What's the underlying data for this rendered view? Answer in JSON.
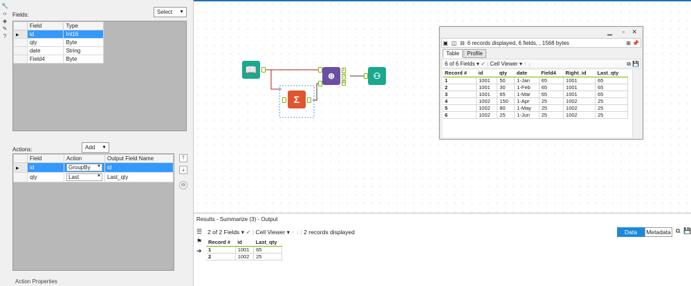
{
  "left_panel": {
    "fields_label": "Fields:",
    "select_button": "Select",
    "fields_headers": [
      "Field",
      "Type"
    ],
    "fields_rows": [
      {
        "field": "id",
        "type": "Int16",
        "selected": true
      },
      {
        "field": "qty",
        "type": "Byte",
        "selected": false
      },
      {
        "field": "date",
        "type": "String",
        "selected": false
      },
      {
        "field": "Field4",
        "type": "Byte",
        "selected": false
      }
    ],
    "actions_label": "Actions:",
    "add_button": "Add",
    "actions_headers": [
      "Field",
      "Action",
      "Output Field Name"
    ],
    "actions_rows": [
      {
        "field": "id",
        "action": "GroupBy",
        "output": "id",
        "selected": true
      },
      {
        "field": "qty",
        "action": "Last",
        "output": "Last_qty",
        "selected": false
      }
    ],
    "action_properties_label": "Action Properties"
  },
  "browse_window": {
    "status_text": "6 records displayed, 6 fields, , 1568 bytes",
    "tabs": [
      "Table",
      "Profile"
    ],
    "fields_selector": "6 of 6 Fields",
    "viewer_selector": "Cell Viewer",
    "headers": [
      "Record #",
      "id",
      "qty",
      "date",
      "Field4",
      "Right_id",
      "Last_qty"
    ],
    "rows": [
      [
        "1",
        "1001",
        "50",
        "1-Jan",
        "65",
        "1001",
        "65"
      ],
      [
        "2",
        "1001",
        "30",
        "1-Feb",
        "65",
        "1001",
        "65"
      ],
      [
        "3",
        "1001",
        "65",
        "1-Mar",
        "65",
        "1001",
        "65"
      ],
      [
        "4",
        "1002",
        "150",
        "1-Apr",
        "25",
        "1002",
        "25"
      ],
      [
        "5",
        "1002",
        "80",
        "1-May",
        "25",
        "1002",
        "25"
      ],
      [
        "6",
        "1002",
        "25",
        "1-Jun",
        "25",
        "1002",
        "25"
      ]
    ]
  },
  "results": {
    "title": "Results - Summarize (3) - Output",
    "fields_selector": "2 of 2 Fields",
    "viewer_selector": "Cell Viewer",
    "status_text": "2 records displayed",
    "data_button": "Data",
    "metadata_button": "Metadata",
    "headers": [
      "Record #",
      "id",
      "Last_qty"
    ],
    "rows": [
      [
        "1",
        "1001",
        "65"
      ],
      [
        "2",
        "1002",
        "25"
      ]
    ]
  },
  "canvas": {
    "join_anchor_labels": [
      "L",
      "J",
      "R"
    ]
  },
  "colors": {
    "input_tool": "#1aa88f",
    "summarize_tool": "#e0552f",
    "join_tool": "#6b4fa3",
    "browse_tool": "#1aa88f",
    "selection_blue": "#3399ff",
    "data_button": "#1e88d8"
  }
}
